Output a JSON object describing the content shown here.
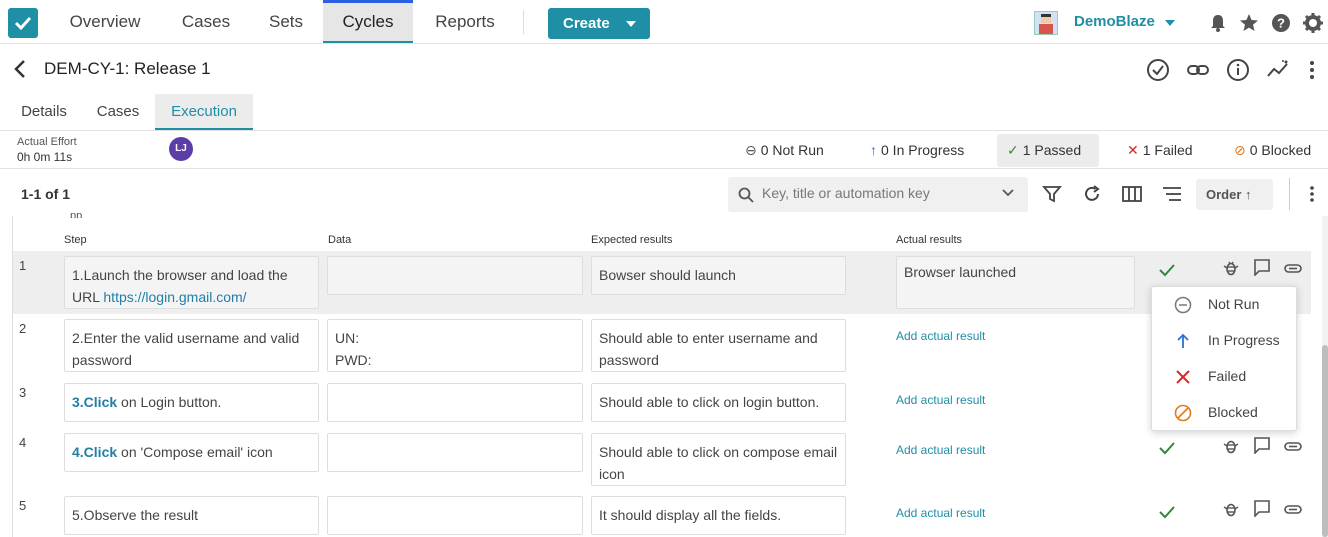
{
  "nav": {
    "tabs": [
      {
        "label": "Overview"
      },
      {
        "label": "Cases"
      },
      {
        "label": "Sets"
      },
      {
        "label": "Cycles"
      },
      {
        "label": "Reports"
      }
    ],
    "create_label": "Create",
    "project_name": "DemoBlaze",
    "accent_color": "#1f8fa6"
  },
  "header": {
    "title": "DEM-CY-1: Release 1"
  },
  "subtabs": [
    {
      "label": "Details"
    },
    {
      "label": "Cases"
    },
    {
      "label": "Execution"
    }
  ],
  "effort": {
    "label": "Actual Effort",
    "value": "0h 0m 11s",
    "assignee_initials": "LJ"
  },
  "status_counts": [
    {
      "symbol": "⊖",
      "label": "0 Not Run",
      "color": "#555"
    },
    {
      "symbol": "↑",
      "label": "0 In Progress",
      "color": "#2a6fd6"
    },
    {
      "symbol": "✓",
      "label": "1 Passed",
      "color": "#2e8b3a"
    },
    {
      "symbol": "✕",
      "label": "1 Failed",
      "color": "#d12b2b"
    },
    {
      "symbol": "⊘",
      "label": "0 Blocked",
      "color": "#e07a1a"
    }
  ],
  "toolbar": {
    "count": "1-1 of 1",
    "search_placeholder": "Key, title or automation key",
    "order_label": "Order ↑"
  },
  "table": {
    "clipped_text": "pp",
    "headers": {
      "step": "Step",
      "data": "Data",
      "expected": "Expected results",
      "actual": "Actual results"
    },
    "add_actual_label": "Add actual result",
    "rows": [
      {
        "num": "1",
        "step_plain": "1.Launch the browser and load the URL ",
        "step_link": "https://login.gmail.com/",
        "data_line1": "",
        "data_line2": "",
        "expected": "Bowser should launch",
        "actual": "Browser launched"
      },
      {
        "num": "2",
        "step_plain": "2.Enter the valid username and valid password",
        "data_line1": "UN:",
        "data_line2": "PWD:",
        "expected": "Should able to enter username and password"
      },
      {
        "num": "3",
        "step_link": "3.Click",
        "step_plain": " on Login button.",
        "expected": "Should able to click on login button."
      },
      {
        "num": "4",
        "step_link": "4.Click",
        "step_plain": " on 'Compose email' icon",
        "expected": "Should able to click on compose email icon"
      },
      {
        "num": "5",
        "step_plain": "5.Observe the result",
        "expected": "It should display all the fields."
      }
    ]
  },
  "status_menu": [
    {
      "label": "Not Run",
      "icon": "minus-circle-icon"
    },
    {
      "label": "In Progress",
      "icon": "arrow-up-icon"
    },
    {
      "label": "Failed",
      "icon": "x-icon"
    },
    {
      "label": "Blocked",
      "icon": "blocked-icon"
    }
  ]
}
